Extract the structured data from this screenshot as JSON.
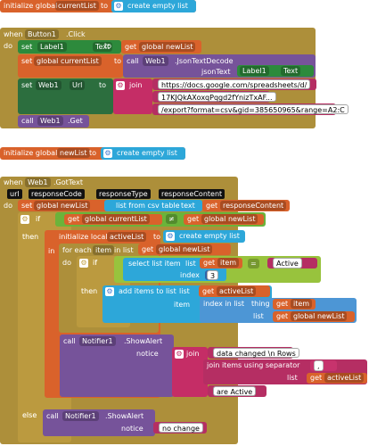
{
  "block1": {
    "initialize": "initialize global",
    "var": "currentList",
    "to": "to",
    "create": "create empty list"
  },
  "block2": {
    "when": "when",
    "component": "Button1",
    "event": ".Click",
    "do": "do",
    "set1": {
      "set": "set",
      "comp": "Label1",
      "prop": "Text",
      "to": "to",
      "get": "get",
      "var": "global newList"
    },
    "set2": {
      "set": "set",
      "var": "global currentList",
      "to": "to",
      "call": "call",
      "comp": "Web1",
      "method": ".JsonTextDecode",
      "param": "jsonText",
      "comp2": "Label1",
      "prop2": "Text"
    },
    "set3": {
      "set": "set",
      "comp": "Web1",
      "prop": "Url",
      "to": "to",
      "join": "join",
      "str1": "https://docs.google.com/spreadsheets/d/",
      "str2": "17KJQkAXoxqPqgd2fYnizTxAF...",
      "str3": "/export?format=csv&gid=385650965&range=A2:C"
    },
    "callget": {
      "call": "call",
      "comp": "Web1",
      "method": ".Get"
    }
  },
  "block3": {
    "initialize": "initialize global",
    "var": "newList",
    "to": "to",
    "create": "create empty list"
  },
  "block4": {
    "when": "when",
    "component": "Web1",
    "event": ".GotText",
    "params": [
      "url",
      "responseCode",
      "responseType",
      "responseContent"
    ],
    "do": "do",
    "set": {
      "set": "set",
      "var": "global newList",
      "to": "to",
      "list_from": "list from csv table",
      "text": "text",
      "get": "get",
      "arg": "responseContent"
    },
    "if": {
      "if": "if",
      "get1": "get",
      "var1": "global currentList",
      "op": "≠",
      "get2": "get",
      "var2": "global newList",
      "then": "then",
      "else": "else"
    },
    "init_local": {
      "label": "initialize local",
      "var": "activeList",
      "to": "to",
      "create": "create empty list",
      "in": "in"
    },
    "foreach": {
      "label": "for each",
      "item": "item",
      "in": "in list",
      "get": "get",
      "list": "global newList",
      "do": "do"
    },
    "inner_if": {
      "if": "if",
      "select": "select list item",
      "list_label": "list",
      "get": "get",
      "item": "item",
      "eq": "=",
      "active": "Active",
      "index_label": "index",
      "index": "3",
      "then": "then"
    },
    "add": {
      "label": "add items to list",
      "list_label": "list",
      "get": "get",
      "list": "activeList",
      "item_label": "item",
      "index_in": "index in list",
      "thing": "thing",
      "get2": "get",
      "item": "item",
      "list2_label": "list",
      "get3": "get",
      "list2": "global newList"
    },
    "alert": {
      "call": "call",
      "comp": "Notifier1",
      "method": ".ShowAlert",
      "notice": "notice",
      "join": "join",
      "str1": "data changed \\n Rows",
      "join_sep": "join items using separator",
      "sep": ",",
      "list_label": "list",
      "get": "get",
      "list": "activeList",
      "str2": "are Active"
    },
    "else_alert": {
      "call": "call",
      "comp": "Notifier1",
      "method": ".ShowAlert",
      "notice": "notice",
      "str": "no change"
    }
  },
  "colors": {
    "variables": "#d9622b",
    "control": "#ad8f3a",
    "components": "#2d8a3c",
    "lists": "#2da7d9",
    "text": "#c52d66",
    "logic": "#6bb33a",
    "notifier": "#76539a"
  }
}
